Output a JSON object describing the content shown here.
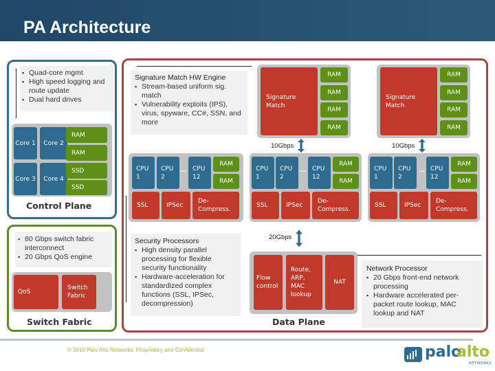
{
  "slide": {
    "title": "PA Architecture",
    "footer": "© 2010 Palo Alto Networks. Proprietary and Confidential",
    "logo": {
      "icon": "palo-alto-logo-icon",
      "word1": "palo",
      "word2": "alto",
      "sub": "NETWORKS"
    }
  },
  "colors": {
    "control": "#2e6b8e",
    "security": "#c0392b",
    "switch": "#5e9018",
    "frame_control": "#3b6a86",
    "frame_security": "#a7453a",
    "frame_switch": "#5e8a2a"
  },
  "control_plane": {
    "bullets": [
      "Quad-core mgmt",
      "High speed logging and route update",
      "Dual hard drives"
    ],
    "cores": [
      "Core 1",
      "Core 2",
      "Core 3",
      "Core 4"
    ],
    "memory": [
      "RAM",
      "RAM",
      "SSD",
      "SSD"
    ],
    "label": "Control Plane"
  },
  "switch_fabric": {
    "bullets": [
      "80 Gbps switch fabric interconnect",
      "20 Gbps QoS engine"
    ],
    "blocks": [
      "QoS",
      "Switch Fabric"
    ],
    "label": "Switch Fabric"
  },
  "signature_engine_note": {
    "heading": "Signature Match HW Engine",
    "bullets": [
      "Stream-based uniform sig. match",
      "Vulnerability exploits (IPS), virus, spyware, CC#, SSN, and more"
    ]
  },
  "signature_match_units": [
    {
      "label": "Signature Match",
      "rams": [
        "RAM",
        "RAM",
        "RAM",
        "RAM"
      ],
      "link": "10Gbps"
    },
    {
      "label": "Signature Match",
      "rams": [
        "RAM",
        "RAM",
        "RAM",
        "RAM"
      ],
      "link": "10Gbps"
    }
  ],
  "security_processors": [
    {
      "cpus": [
        "CPU 1",
        "CPU 2",
        "CPU 12"
      ],
      "ellipsis": "…",
      "rams": [
        "RAM",
        "RAM"
      ],
      "accel": [
        "SSL",
        "IPSec",
        "De-Compress."
      ]
    },
    {
      "cpus": [
        "CPU 1",
        "CPU 2",
        "CPU 12"
      ],
      "ellipsis": "…",
      "rams": [
        "RAM",
        "RAM"
      ],
      "accel": [
        "SSL",
        "IPSec",
        "De-Compress."
      ]
    },
    {
      "cpus": [
        "CPU 1",
        "CPU 2",
        "CPU 12"
      ],
      "ellipsis": "…",
      "rams": [
        "RAM",
        "RAM"
      ],
      "accel": [
        "SSL",
        "IPSec",
        "De-Compress."
      ]
    }
  ],
  "security_note": {
    "heading": "Security Processors",
    "bullets": [
      "High density parallel processing for flexible security functionality",
      "Hardware-acceleration for standardized complex functions (SSL, IPSec, decompression)"
    ]
  },
  "data_plane": {
    "link": "20Gbps",
    "blocks": [
      "Flow control",
      "Route, ARP, MAC lookup",
      "NAT"
    ],
    "label": "Data Plane"
  },
  "network_note": {
    "heading": "Network Processor",
    "bullets": [
      "20 Gbps front-end network processing",
      "Hardware accelerated per-packet route lookup, MAC lookup and NAT"
    ]
  }
}
